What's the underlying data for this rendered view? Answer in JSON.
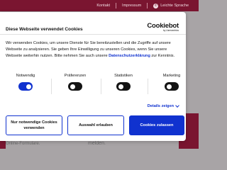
{
  "site": {
    "nav": {
      "kontakt": "Kontakt",
      "impressum": "Impressum",
      "leichte_sprache": "Leichte Sprache"
    },
    "bg_text_left": "Online-Formulare.",
    "bg_text_mid": "melden."
  },
  "dialog": {
    "title": "Diese Webseite verwendet Cookies",
    "logo_main": "Cookiebot",
    "logo_sub": "by Usercentrics",
    "body_pre": "Wir verwenden Cookies, um unsere Dienste für Sie bereitzustellen und die Zugriffe auf unsere Webseite zu analysieren. Sie geben Ihre Einwilligung zu unseren Cookies, wenn Sie unsere Webseite weiterhin nutzen. Bitte nehmen Sie auch unsere ",
    "body_link": "Datenschutzerklärung",
    "body_post": " zur Kenntnis.",
    "toggles": [
      {
        "label": "Notwendig",
        "on": true
      },
      {
        "label": "Präferenzen",
        "on": false
      },
      {
        "label": "Statistiken",
        "on": false
      },
      {
        "label": "Marketing",
        "on": false
      }
    ],
    "details_label": "Details zeigen",
    "buttons": {
      "necessary_only": "Nur notwendige Cookies verwenden",
      "allow_selection": "Auswahl erlauben",
      "allow_all": "Cookies zulassen"
    },
    "colors": {
      "accent": "#1032cf",
      "brand": "#7a1530"
    }
  }
}
